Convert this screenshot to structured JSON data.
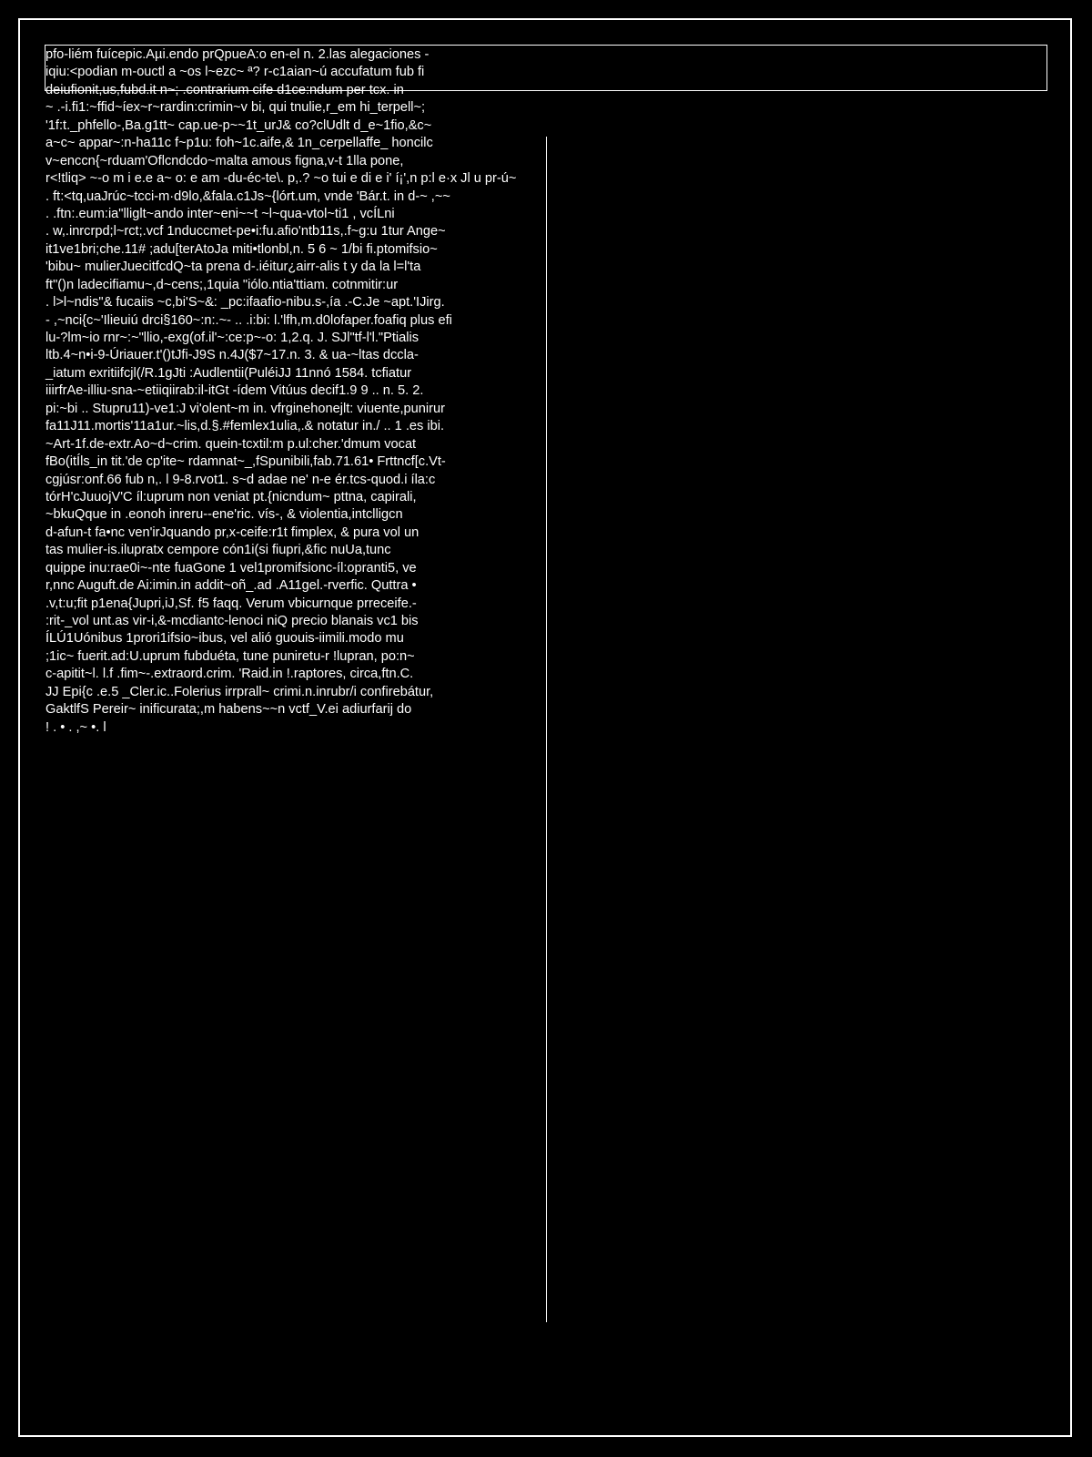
{
  "document": {
    "lines": [
      "pfo-liém fuícepic.Aµi.endo prQpueA:o en-el n. 2.las alegaciones -",
      "iqiu:<podian m-ouctl a ~os l~ezc~ ª? r-c1aian~ú accufatum fub fi",
      "deiufionit,us,fubd.it n~; .contrarium cife d1ce:ndum per tcx. in",
      "~ .-i.fi1:~ffid~íex~r~rardin:crimin~v bi, qui tnulie,r_em hi_terpell~;",
      "'1f:t._phfello-,Ba.g1tt~ cap.ue-p~~1t_urJ& co?clUdlt d_e~1fio,&c~",
      "a~c~ appar~:n-ha11c f~p1u: foh~1c.aife,& 1n_cerpellaffe_ honcilc",
      "v~enccn{~rduam'Oflcndcdo~malta amous figna,v-t 1lla pone,",
      "r<!tliq> ~-o m i e.e a~ o: e am -du-éc-te\\. p,.? ~o tui e di e i' í¡',n p:l e·x Jl u pr-ú~",
      ". ft:<tq,uaJrúc~tcci-m·d9lo,&fala.c1Js~{lórt.um, vnde 'Bár.t. in d-~ ,~~",
      ". .ftn:.eum:ia\"lliglt~ando inter~eni~~t ~l~qua-vtol~ti1 , vcÍLni",
      ". w,.inrcrpd;l~rct;.vcf 1nduccmet-pe•i:fu.afio'ntb11s,.f~g:u 1tur Ange~",
      "it1ve1bri;che.11# ;adu[terAtoJa miti•tlonbl,n. 5 6 ~ 1/bi fi.ptomifsio~",
      "'bibu~ mulierJuecitfcdQ~ta prena d-.iéitur¿airr-alis t y da la l=l'ta",
      "ft\"()n ladecifiamu~,d~cens;,1quia \"iólo.ntia'ttiam. cotnmitir:ur",
      ". l>l~ndis\"& fucaiis ~c,bi'S~&: _pc:ifaafio-nibu.s-,ía .-C.Je ~apt.'IJirg.",
      "- ,~nci{c~'Ilieuiú drci§160~:n:.~- .. .i:bi: l.'lfh,m.d0lofaper.foafiq plus efi",
      "lu-?lm~io rnr~:~\"llio,-exg(of.il'~:ce:p~-o: 1,2.q. J. SJl\"tf-l'l.\"Ptialis",
      "ltb.4~n•i-9-Úriauer.t'()tJfi-J9S n.4J($7~17.n. 3. & ua-~ltas dccla-",
      "_iatum exritiifcjl(/R.1gJti :Audlentii(PuléiJJ 11nnó 1584. tcfiatur",
      "iiirfrAe-illiu-sna-~etiiqiirab:il-itGt -ídem Vitúus decif1.9 9 .. n. 5. 2.",
      "pi:~bi .. Stupru11)-ve1:J vi'olent~m in. vfrginehonejlt: viuente,punirur",
      "fa11J11.mortis'11a1ur.~lis,d.§.#femlex1ulia,.& notatur in./ .. 1 .es ibi.",
      "~Art-1f.de-extr.Ao~d~crim. quein-tcxtil:m p.ul:cher.'dmum vocat",
      "fBo(itÍls_in tit.'de cp'ite~ rdamnat~_,fSpunibili,fab.71.61• Frttncf[c.Vt-",
      "cgjúsr:onf.66 fub n,. l 9-8.rvot1. s~d adae ne' n-e ér.tcs-quod.i íla:c",
      "tórH'cJuuojV'C íl:uprum non veniat pt.{nicndum~ pttna, capirali,",
      "~bkuQque in .eonoh inreru--ene'ric. vís-, & violentia,intclligcn",
      "d-afun-t fa•nc ven'irJquando pr,x-ceife:r1t fimplex, & pura vol un",
      "tas mulier-is.ilupratx cempore cón1i(si fiupri,&fic nuUa,tunc",
      "quippe inu:rae0i~-nte fuaGone 1 vel1promifsionc-íl:opranti5, ve",
      "r,nnc Auguft.de Ai:imin.in addit~oñ_.ad .A11gel.-rverfic. Quttra •",
      ".v,t:u;fit p1ena{Jupri,iJ,Sf. f5 faqq. Verum vbicurnque prreceife.-",
      ":rit-_vol unt.as vir-i,&-mcdiantc-lenoci niQ precio blanais vc1 bis",
      "ÍLÚ1Uónibus 1prori1ifsio~ibus, vel alió guouis-iimili.modo mu",
      ";1ic~ fuerit.ad:U.uprum fubduéta, tune puniretu-r !lupran, po:n~",
      "c-apitit~l. l.f .fim~-.extraord.crim. 'Raid.in !.raptores, circa,ftn.C.",
      "JJ Epi{c .e.5 _Cler.ic..Folerius irrprall~ crimi.n.inrubr/i confirebátur,",
      "GaktlfS Pereir~ inificurata;,m habens~~n vctf_V.ei adiurfarij do",
      "! . • . ,~ •. l"
    ]
  },
  "colors": {
    "background": "#000000",
    "foreground": "#ffffff"
  }
}
